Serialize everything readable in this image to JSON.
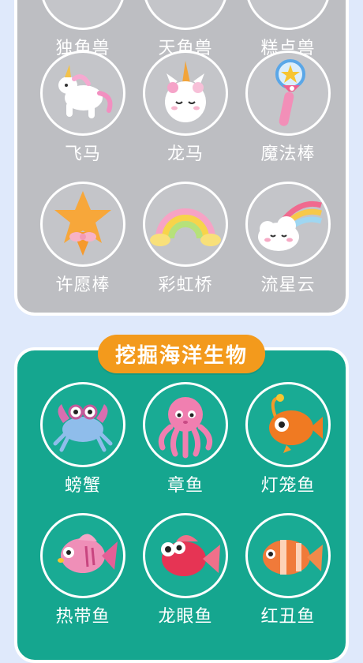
{
  "colors": {
    "background": "#dfe9fb",
    "gray_panel": "#bdbec2",
    "teal_panel": "#15a68f",
    "badge": "#f39a1c"
  },
  "fantasy_section": {
    "items": [
      {
        "label": "独角兽",
        "icon": "unicorn-icon"
      },
      {
        "label": "天角兽",
        "icon": "winged-unicorn-icon"
      },
      {
        "label": "糕点兽",
        "icon": "pastry-beast-icon"
      },
      {
        "label": "飞马",
        "icon": "pegasus-icon"
      },
      {
        "label": "龙马",
        "icon": "unicorn-head-icon"
      },
      {
        "label": "魔法棒",
        "icon": "magic-wand-icon"
      },
      {
        "label": "许愿棒",
        "icon": "wish-star-wand-icon"
      },
      {
        "label": "彩虹桥",
        "icon": "rainbow-icon"
      },
      {
        "label": "流星云",
        "icon": "shooting-star-cloud-icon"
      }
    ]
  },
  "ocean_section": {
    "title": "挖掘海洋生物",
    "items": [
      {
        "label": "螃蟹",
        "icon": "crab-icon"
      },
      {
        "label": "章鱼",
        "icon": "octopus-icon"
      },
      {
        "label": "灯笼鱼",
        "icon": "lantern-fish-icon"
      },
      {
        "label": "热带鱼",
        "icon": "tropical-fish-icon"
      },
      {
        "label": "龙眼鱼",
        "icon": "dragon-eye-fish-icon"
      },
      {
        "label": "红丑鱼",
        "icon": "clownfish-icon"
      }
    ]
  }
}
